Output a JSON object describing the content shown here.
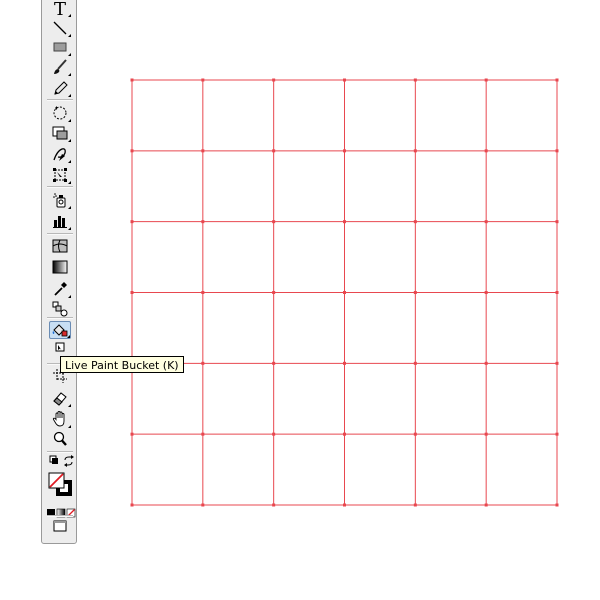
{
  "toolbar": {
    "tools": [
      {
        "name": "type-tool",
        "icon": "type-icon",
        "glyph": "T"
      },
      {
        "name": "line-segment-tool",
        "icon": "line-segment-icon"
      },
      {
        "name": "rectangle-tool",
        "icon": "rectangle-icon"
      },
      {
        "name": "paintbrush-tool",
        "icon": "paintbrush-icon"
      },
      {
        "name": "pencil-tool",
        "icon": "pencil-icon"
      },
      {
        "name": "rotate-tool",
        "icon": "rotate-icon"
      },
      {
        "name": "scale-tool",
        "icon": "scale-icon"
      },
      {
        "name": "warp-tool",
        "icon": "warp-icon"
      },
      {
        "name": "free-transform-tool",
        "icon": "free-transform-icon"
      },
      {
        "name": "symbol-sprayer-tool",
        "icon": "symbol-sprayer-icon"
      },
      {
        "name": "column-graph-tool",
        "icon": "column-graph-icon"
      },
      {
        "name": "mesh-tool",
        "icon": "mesh-icon"
      },
      {
        "name": "gradient-tool",
        "icon": "gradient-icon"
      },
      {
        "name": "eyedropper-tool",
        "icon": "eyedropper-icon"
      },
      {
        "name": "blend-tool",
        "icon": "blend-icon"
      },
      {
        "name": "live-paint-bucket-tool",
        "icon": "live-paint-bucket-icon",
        "active": true
      },
      {
        "name": "live-paint-selection-tool",
        "icon": "live-paint-selection-icon"
      },
      {
        "name": "crop-area-tool",
        "icon": "crop-area-icon"
      },
      {
        "name": "eraser-tool",
        "icon": "eraser-icon"
      },
      {
        "name": "hand-tool",
        "icon": "hand-icon"
      },
      {
        "name": "zoom-tool",
        "icon": "zoom-icon"
      }
    ],
    "fill_color": "none",
    "stroke_color": "#000000"
  },
  "tooltip": {
    "text": "Live Paint Bucket (K)"
  },
  "canvas": {
    "grid_color": "#e8474f",
    "columns": 6,
    "rows": 6
  }
}
